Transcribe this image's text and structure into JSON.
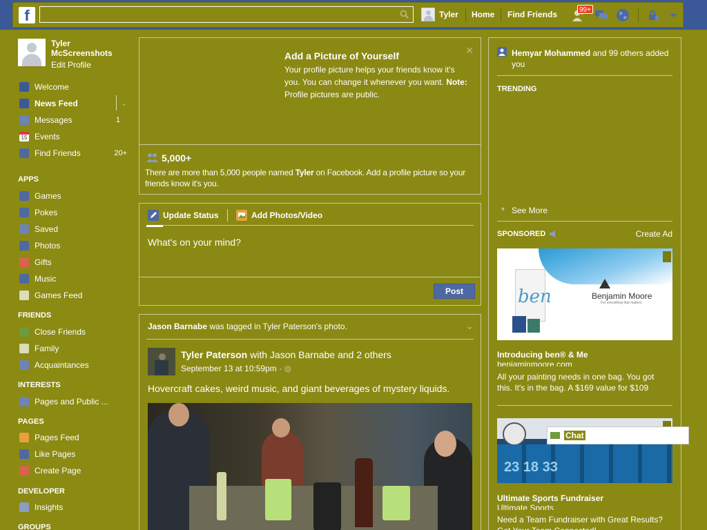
{
  "topbar": {
    "logo": "f",
    "search_placeholder": "",
    "user_name": "Tyler",
    "home": "Home",
    "find_friends": "Find Friends",
    "friend_requests_badge": "99+",
    "colors": {
      "topbar": "#3b5998",
      "badge": "#f03d25"
    }
  },
  "left": {
    "profile": {
      "name": "Tyler McScreenshots",
      "edit": "Edit Profile"
    },
    "main_items": [
      {
        "label": "Welcome",
        "icon": "facebook-icon",
        "count": ""
      },
      {
        "label": "News Feed",
        "icon": "news-feed-icon",
        "count": ""
      },
      {
        "label": "Messages",
        "icon": "messages-icon",
        "count": "1"
      },
      {
        "label": "Events",
        "icon": "calendar-icon",
        "count": ""
      },
      {
        "label": "Find Friends",
        "icon": "find-friends-icon",
        "count": "20+"
      }
    ],
    "apps_header": "APPS",
    "apps": [
      {
        "label": "Games",
        "icon": "games-icon"
      },
      {
        "label": "Pokes",
        "icon": "pokes-icon"
      },
      {
        "label": "Saved",
        "icon": "saved-icon"
      },
      {
        "label": "Photos",
        "icon": "photos-icon"
      },
      {
        "label": "Gifts",
        "icon": "gifts-icon"
      },
      {
        "label": "Music",
        "icon": "music-icon"
      },
      {
        "label": "Games Feed",
        "icon": "games-feed-icon"
      }
    ],
    "friends_header": "FRIENDS",
    "friends": [
      {
        "label": "Close Friends",
        "icon": "close-friends-icon"
      },
      {
        "label": "Family",
        "icon": "family-icon"
      },
      {
        "label": "Acquaintances",
        "icon": "acquaintances-icon"
      }
    ],
    "interests_header": "INTERESTS",
    "interests": [
      {
        "label": "Pages and Public ...",
        "icon": "pages-public-icon"
      }
    ],
    "pages_header": "PAGES",
    "pages": [
      {
        "label": "Pages Feed",
        "icon": "pages-feed-icon"
      },
      {
        "label": "Like Pages",
        "icon": "like-pages-icon"
      },
      {
        "label": "Create Page",
        "icon": "create-page-icon"
      }
    ],
    "developer_header": "DEVELOPER",
    "developer": [
      {
        "label": "Insights",
        "icon": "insights-icon"
      }
    ],
    "groups_header": "GROUPS"
  },
  "profile_prompt": {
    "title": "Add a Picture of Yourself",
    "text": "Your profile picture helps your friends know it's you. You can change it whenever you want.",
    "note_label": "Note:",
    "note_text": "Profile pictures are public.",
    "count": "5,000+",
    "count_text_pre": "There are more than 5,000 people named ",
    "count_name": "Tyler",
    "count_text_post": " on Facebook. Add a profile picture so your friends know it's you."
  },
  "composer": {
    "tab_status": "Update Status",
    "tab_photos": "Add Photos/Video",
    "placeholder": "What's on your mind?",
    "post_button": "Post"
  },
  "story": {
    "header_actor": "Jason Barnabe",
    "header_text": " was tagged in Tyler Paterson's photo.",
    "author": "Tyler Paterson",
    "with_text": " with Jason Barnabe and 2 others",
    "timestamp": "September 13 at 10:59pm",
    "sep": "·",
    "message": "Hovercraft cakes, weird music, and giant beverages of mystery liquids."
  },
  "right": {
    "ticker_name": "Hemyar Mohammed",
    "ticker_text": " and 99 others added you",
    "trending_header": "TRENDING",
    "see_more": "See More",
    "sponsored_header": "SPONSORED",
    "create_ad": "Create Ad",
    "ad1": {
      "brand": "Benjamin Moore",
      "tagline": "For everything that matters",
      "title": "Introducing ben® & Me",
      "domain": "benjaminmoore.com",
      "text": "All your painting needs in one bag. You got this. It's in the bag. A $169 value for $109"
    },
    "ad2": {
      "title": "Ultimate Sports Fundraiser",
      "domain": "Ultimate Sports",
      "text": "Need a Team Fundraiser with Great Results? Get Your Team Connected!"
    },
    "chat_label": "Chat"
  }
}
